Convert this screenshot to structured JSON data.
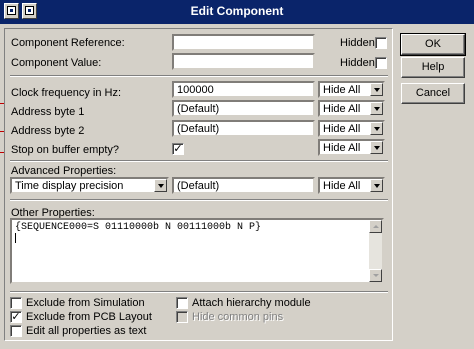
{
  "window": {
    "title": "Edit Component"
  },
  "fields": {
    "reference": {
      "label": "Component Reference:",
      "value": ""
    },
    "value": {
      "label": "Component Value:",
      "value": ""
    },
    "hidden_label": "Hidden:",
    "clock": {
      "label": "Clock frequency in Hz:",
      "value": "100000",
      "visibility": "Hide All"
    },
    "address1": {
      "label": "Address byte 1",
      "value": "(Default)",
      "visibility": "Hide All"
    },
    "address2": {
      "label": "Address byte 2",
      "value": "(Default)",
      "visibility": "Hide All"
    },
    "stop": {
      "label": "Stop on buffer empty?",
      "checked": true,
      "visibility": "Hide All"
    }
  },
  "advanced": {
    "label": "Advanced Properties:",
    "property": "Time display precision",
    "value": "(Default)",
    "visibility": "Hide All"
  },
  "other": {
    "label": "Other Properties:",
    "text": "{SEQUENCE000=S 01110000b N 00111000b N P}"
  },
  "options": {
    "exclude_sim": {
      "label": "Exclude from Simulation",
      "checked": false
    },
    "exclude_pcb": {
      "label": "Exclude from PCB Layout",
      "checked": true
    },
    "edit_all": {
      "label": "Edit all properties as text",
      "checked": false
    },
    "attach_hier": {
      "label": "Attach hierarchy module",
      "checked": false
    },
    "hide_pins": {
      "label": "Hide common pins",
      "checked": false,
      "disabled": true
    }
  },
  "buttons": {
    "ok": "OK",
    "help": "Help",
    "cancel": "Cancel"
  },
  "colors": {
    "titlebar": "#0a246a",
    "face": "#d4d0c8",
    "marker": "#c00000"
  },
  "icons": {
    "window_icon_1": "window-icon",
    "window_icon_2": "window-icon"
  }
}
